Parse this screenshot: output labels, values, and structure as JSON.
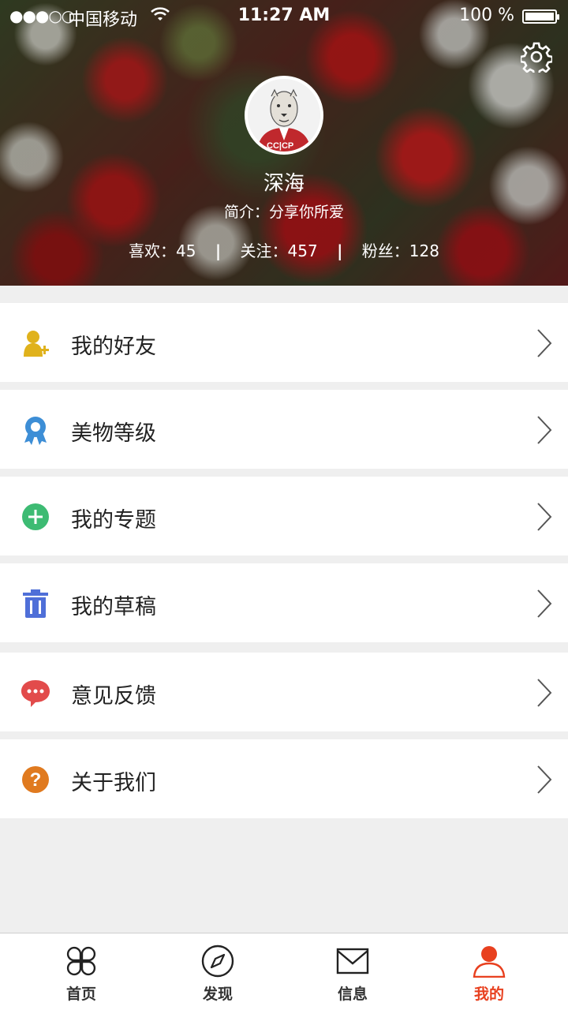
{
  "status_bar": {
    "signal": "●●●○○",
    "carrier": "中国移动",
    "time": "11:27 AM",
    "battery": "100 %"
  },
  "profile": {
    "name": "深海",
    "bio": "简介：分享你所爱",
    "stats": {
      "likes": "喜欢：45",
      "following": "关注：457",
      "fans": "粉丝：128",
      "separator": "|"
    }
  },
  "menu": {
    "items": [
      {
        "label": "我的好友",
        "icon": "add-friend-icon",
        "color": "#e0b21c"
      },
      {
        "label": "美物等级",
        "icon": "badge-icon",
        "color": "#3d8ed6"
      },
      {
        "label": "我的专题",
        "icon": "plus-circle-icon",
        "color": "#3dbb73"
      },
      {
        "label": "我的草稿",
        "icon": "trash-icon",
        "color": "#4f6fd8"
      },
      {
        "label": "意见反馈",
        "icon": "chat-bubble-icon",
        "color": "#e24b4b"
      },
      {
        "label": "关于我们",
        "icon": "question-icon",
        "color": "#e07a1f"
      }
    ]
  },
  "tabbar": {
    "tabs": [
      {
        "label": "首页",
        "icon": "clover-icon"
      },
      {
        "label": "发现",
        "icon": "compass-icon"
      },
      {
        "label": "信息",
        "icon": "envelope-icon"
      },
      {
        "label": "我的",
        "icon": "person-icon",
        "active": true
      }
    ],
    "active_color": "#e8401f"
  }
}
